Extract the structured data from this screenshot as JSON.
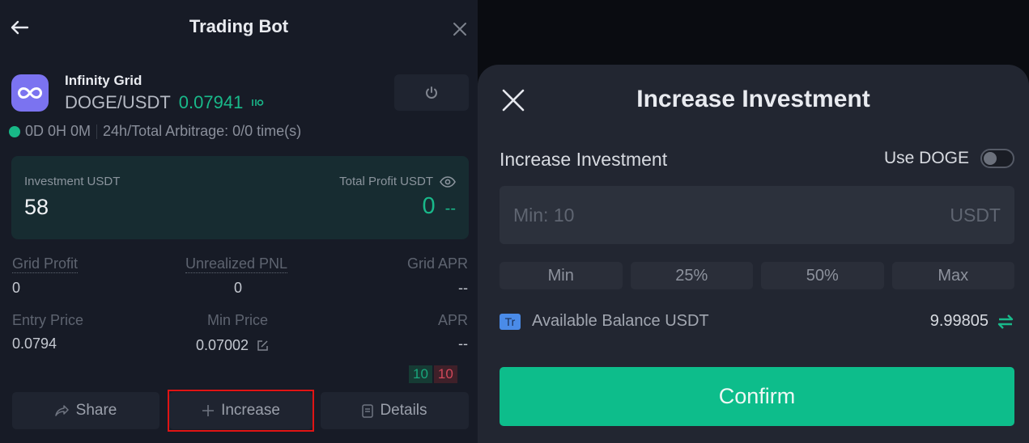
{
  "left_panel": {
    "header": {
      "title": "Trading Bot"
    },
    "bot": {
      "type": "Infinity Grid",
      "pair": "DOGE/USDT",
      "price": "0.07941",
      "runtime": "0D 0H 0M",
      "arbitrage": "24h/Total Arbitrage: 0/0 time(s)"
    },
    "investment_card": {
      "investment_label": "Investment USDT",
      "investment_value": "58",
      "profit_label": "Total Profit USDT",
      "profit_value": "0",
      "profit_change": "--"
    },
    "stats": [
      {
        "label": "Grid Profit",
        "value": "0"
      },
      {
        "label": "Unrealized PNL",
        "value": "0"
      },
      {
        "label": "Grid APR",
        "value": "--"
      },
      {
        "label": "Entry Price",
        "value": "0.0794"
      },
      {
        "label": "Min Price",
        "value": "0.07002"
      },
      {
        "label": "APR",
        "value": "--"
      }
    ],
    "grid_counts": {
      "buy": "10",
      "sell": "10"
    },
    "actions": {
      "share": "Share",
      "increase": "Increase",
      "details": "Details"
    }
  },
  "sheet": {
    "title": "Increase Investment",
    "field_label": "Increase Investment",
    "use_coin_label": "Use DOGE",
    "use_coin_enabled": false,
    "amount_input": {
      "placeholder": "Min: 10",
      "value": "",
      "unit": "USDT"
    },
    "percent_options": [
      "Min",
      "25%",
      "50%",
      "Max"
    ],
    "account_badge": "Tr",
    "balance_label": "Available Balance USDT",
    "balance_value": "9.99805",
    "confirm_label": "Confirm"
  },
  "colors": {
    "accent_green": "#0dbd8b",
    "sell_red": "#d2485a",
    "highlight_red": "#e01414",
    "bot_logo_purple": "#7b73f0"
  }
}
